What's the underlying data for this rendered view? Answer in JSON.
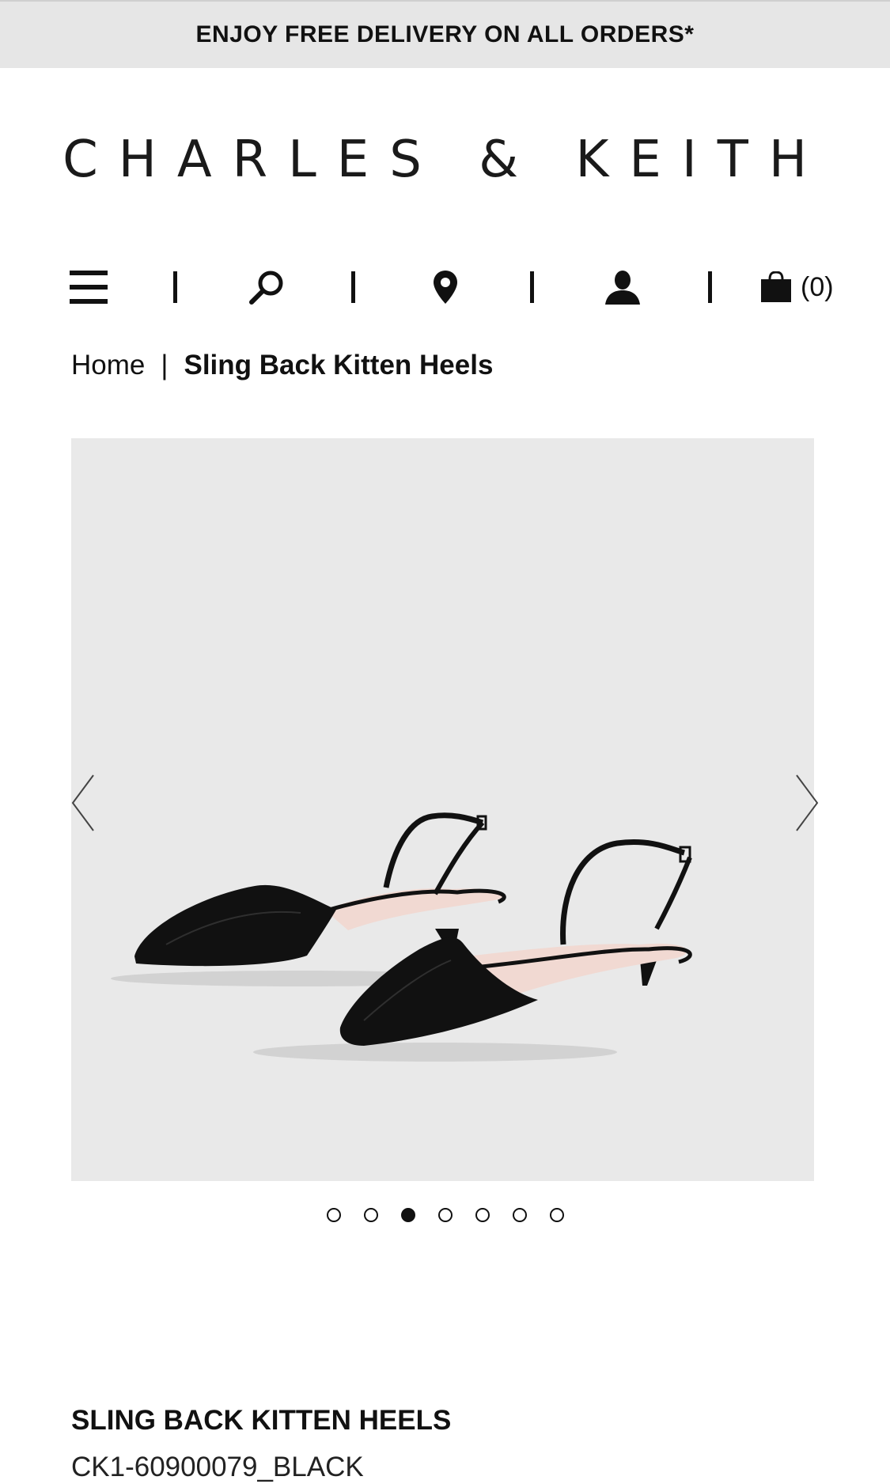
{
  "promo": {
    "text": "ENJOY FREE DELIVERY ON ALL ORDERS*"
  },
  "brand": {
    "logo": "CHARLES & KEITH"
  },
  "toolbar": {
    "icons": [
      "menu-icon",
      "search-icon",
      "location-pin-icon",
      "account-icon",
      "shopping-bag-icon"
    ],
    "cart_count": "(0)"
  },
  "breadcrumb": {
    "home": "Home",
    "separator": "|",
    "current": "Sling Back Kitten Heels"
  },
  "gallery": {
    "total_images": 7,
    "active_index": 2,
    "background": "#e9e9e9"
  },
  "product": {
    "name": "SLING BACK KITTEN HEELS",
    "sku": "CK1-60900079_BLACK"
  },
  "colors": {
    "promo_bg": "#e6e6e6",
    "text": "#111111",
    "shoe": "#111111",
    "lining": "#f1d9d2"
  }
}
